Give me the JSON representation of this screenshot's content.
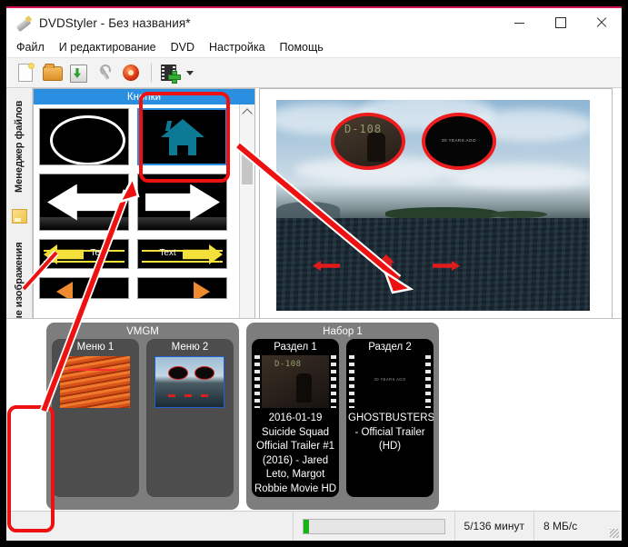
{
  "window": {
    "title": "DVDStyler - Без названия*",
    "app_icon": "dvdstyler-icon",
    "controls": {
      "minimize": "—",
      "maximize": "□",
      "close": "✕"
    }
  },
  "menubar": {
    "items": [
      {
        "label": "Файл",
        "name": "menu-file"
      },
      {
        "label": "И редактирование",
        "name": "menu-edit"
      },
      {
        "label": "DVD",
        "name": "menu-dvd"
      },
      {
        "label": "Настройка",
        "name": "menu-settings"
      },
      {
        "label": "Помощь",
        "name": "menu-help"
      }
    ]
  },
  "toolbar": {
    "buttons": [
      {
        "name": "new-project-icon",
        "title": "Новый"
      },
      {
        "name": "open-folder-icon",
        "title": "Открыть"
      },
      {
        "name": "save-icon",
        "title": "Сохранить"
      },
      {
        "name": "wrench-settings-icon",
        "title": "Настройки"
      },
      {
        "name": "burn-disc-icon",
        "title": "Записать"
      },
      {
        "name": "add-video-icon",
        "title": "Добавить видео"
      }
    ],
    "dropdown_caret": "▾"
  },
  "sidebar": {
    "tabs": [
      {
        "label": "Менеджер файлов",
        "name": "sidebar-tab-file-manager",
        "selected": false
      },
      {
        "label": "Фоновые изображения",
        "name": "sidebar-tab-backgrounds",
        "selected": false
      },
      {
        "label": "Кнопки",
        "name": "sidebar-tab-buttons",
        "selected": true
      }
    ],
    "image_icon": "background-image-icon"
  },
  "buttons_panel": {
    "header": "Кнопки",
    "items": [
      {
        "name": "button-template-ellipse",
        "kind": "ellipse",
        "selected": false
      },
      {
        "name": "button-template-home",
        "kind": "home",
        "selected": true
      },
      {
        "name": "button-template-arrow-left",
        "kind": "arrow-left",
        "selected": false
      },
      {
        "name": "button-template-arrow-right",
        "kind": "arrow-right",
        "selected": false
      },
      {
        "name": "button-template-text-left",
        "kind": "text-arrow-left",
        "label": "Text",
        "selected": false
      },
      {
        "name": "button-template-text-right",
        "kind": "text-arrow-right",
        "label": "Text",
        "selected": false
      },
      {
        "name": "button-template-orange-left",
        "kind": "orange-left",
        "selected": false
      },
      {
        "name": "button-template-orange-right",
        "kind": "orange-right",
        "selected": false
      }
    ],
    "scrollbar": {
      "up": "⌃",
      "down": "⌄"
    }
  },
  "preview": {
    "name": "menu-preview-canvas",
    "oval_buttons": [
      {
        "name": "preview-oval-button-1",
        "text": "D-108"
      },
      {
        "name": "preview-oval-button-2",
        "text": "30 YEARS AGO"
      }
    ],
    "nav": [
      {
        "name": "preview-nav-prev",
        "icon": "arrow-left-icon"
      },
      {
        "name": "preview-nav-home",
        "icon": "home-icon"
      },
      {
        "name": "preview-nav-next",
        "icon": "arrow-right-icon"
      }
    ]
  },
  "timeline": {
    "groups": [
      {
        "title": "VMGM",
        "name": "timeline-group-vmgm",
        "cards": [
          {
            "title": "Меню 1",
            "name": "timeline-menu-1",
            "thumb": "lava",
            "selected": false
          },
          {
            "title": "Меню 2",
            "name": "timeline-menu-2",
            "thumb": "lake",
            "selected": true
          }
        ]
      },
      {
        "title": "Набор 1",
        "name": "timeline-group-titleset-1",
        "cards": [
          {
            "title": "Раздел 1",
            "name": "timeline-chapter-1",
            "thumb": "suicide-squad",
            "caption": "2016-01-19 Suicide Squad Official Trailer #1 (2016) - Jared Leto, Margot Robbie Movie HD"
          },
          {
            "title": "Раздел 2",
            "name": "timeline-chapter-2",
            "thumb": "ghostbusters",
            "thumb_text": "30 YEARS AGO",
            "caption": "GHOSTBUSTERS - Official Trailer (HD)"
          }
        ]
      }
    ]
  },
  "status": {
    "progress_percent": 4,
    "duration": "5/136 минут",
    "speed": "8 МБ/с"
  },
  "colors": {
    "accent_blue": "#2a8fe0",
    "annotation_red": "#ee1111",
    "progress_green": "#17b317",
    "home_teal": "#0d7a95",
    "title_accent": "#d4145a"
  }
}
